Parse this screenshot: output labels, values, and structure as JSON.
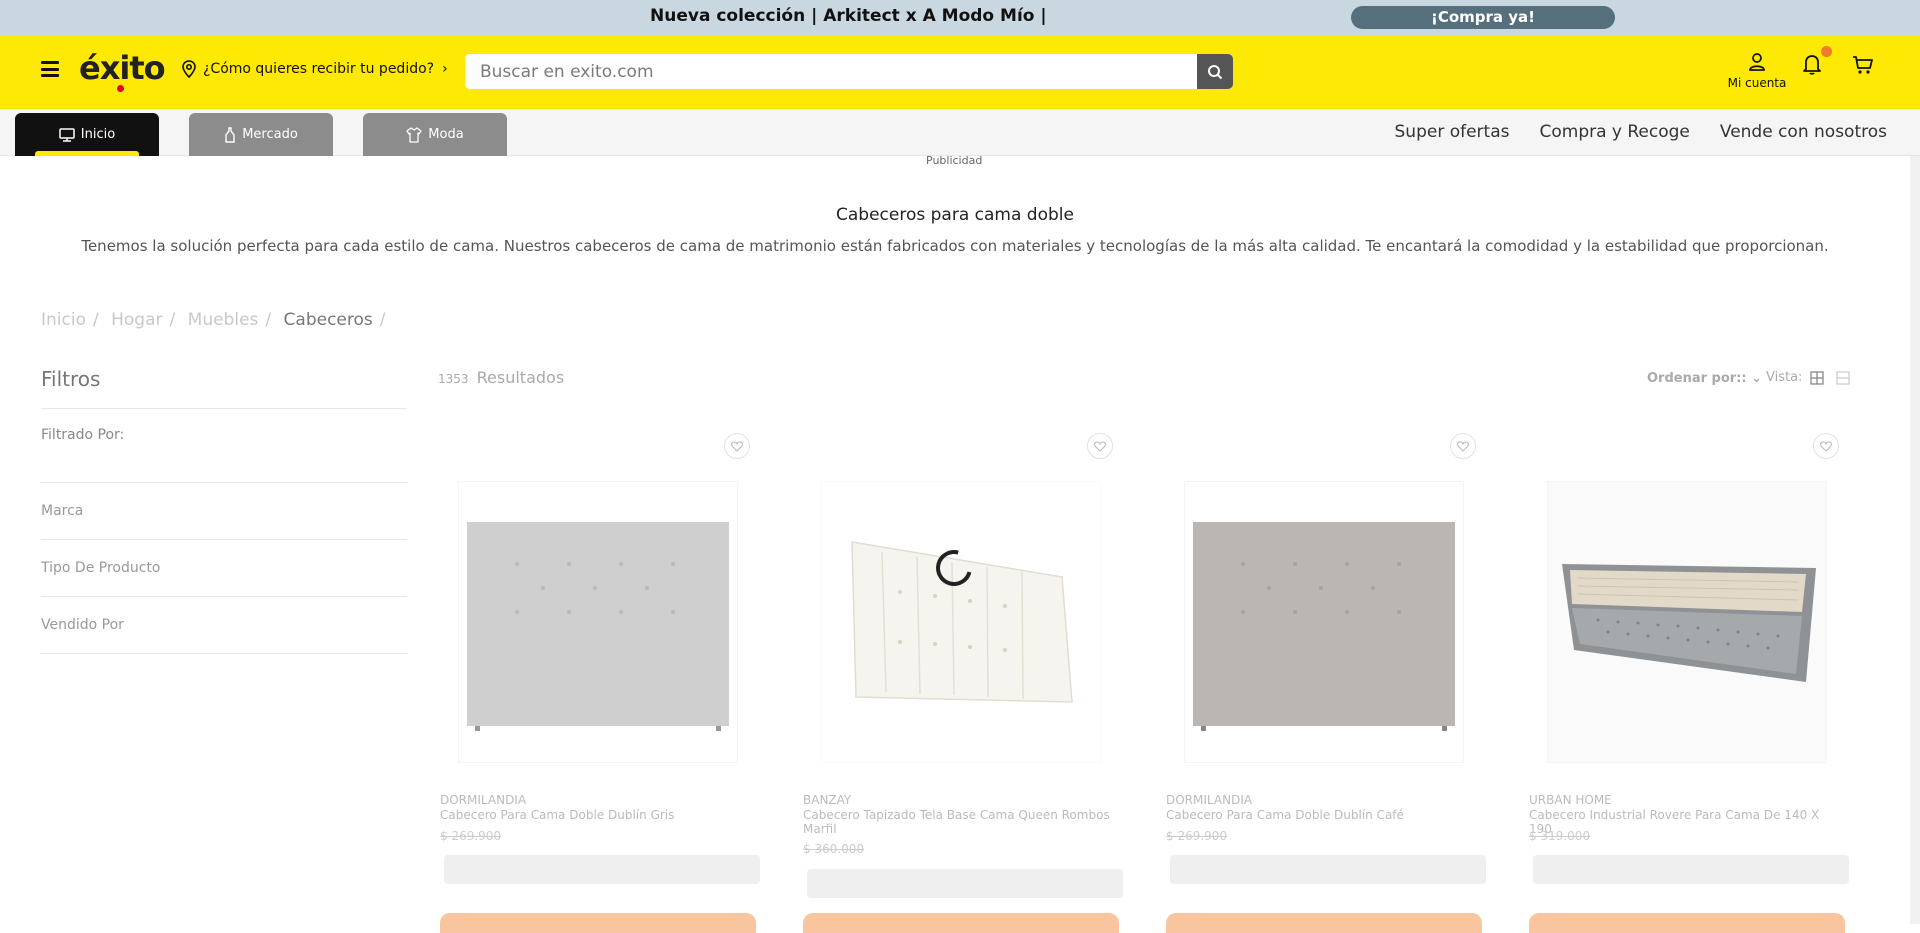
{
  "promo": {
    "text": "Nueva colección | Arkitect x A Modo Mío |",
    "button": "¡Compra ya!"
  },
  "header": {
    "logo": "éxito",
    "delivery": "¿Cómo quieres recibir tu pedido?",
    "search_placeholder": "Buscar en exito.com",
    "account_label": "Mi cuenta"
  },
  "tabs": [
    {
      "label": "Inicio",
      "active": true
    },
    {
      "label": "Mercado"
    },
    {
      "label": "Moda"
    }
  ],
  "nav_links": [
    "Super ofertas",
    "Compra y Recoge",
    "Vende con nosotros"
  ],
  "publicidad": "Publicidad",
  "category": {
    "title": "Cabeceros para cama doble",
    "description": "Tenemos la solución perfecta para cada estilo de cama. Nuestros cabeceros de cama de matrimonio están fabricados con materiales y tecnologías de la más alta calidad. Te encantará la comodidad y la estabilidad que proporcionan."
  },
  "breadcrumb": [
    "Inicio",
    "Hogar",
    "Muebles",
    "Cabeceros"
  ],
  "filters": {
    "title": "Filtros",
    "filtered_by": "Filtrado Por:",
    "items": [
      "Marca",
      "Tipo De Producto",
      "Vendido Por"
    ]
  },
  "results": {
    "count": "1353",
    "label": "Resultados"
  },
  "sort_label": "Ordenar por::",
  "view_label": "Vista:",
  "colors": {
    "brand_yellow": "#fde903",
    "promo_bar": "#c9d8e0",
    "promo_button": "#55707c"
  },
  "products": [
    {
      "brand": "DORMILANDIA",
      "name": "Cabecero Para Cama Doble Dublín Gris",
      "price": "$ 269.900"
    },
    {
      "brand": "BANZAY",
      "name": "Cabecero Tapizado Tela Base Cama Queen Rombos Marfil",
      "price": "$ 360.000"
    },
    {
      "brand": "DORMILANDIA",
      "name": "Cabecero Para Cama Doble Dublín Café",
      "price": "$ 269.900"
    },
    {
      "brand": "URBAN HOME",
      "name": "Cabecero Industrial Rovere Para Cama De 140 X 190",
      "price": "$ 319.000"
    }
  ]
}
